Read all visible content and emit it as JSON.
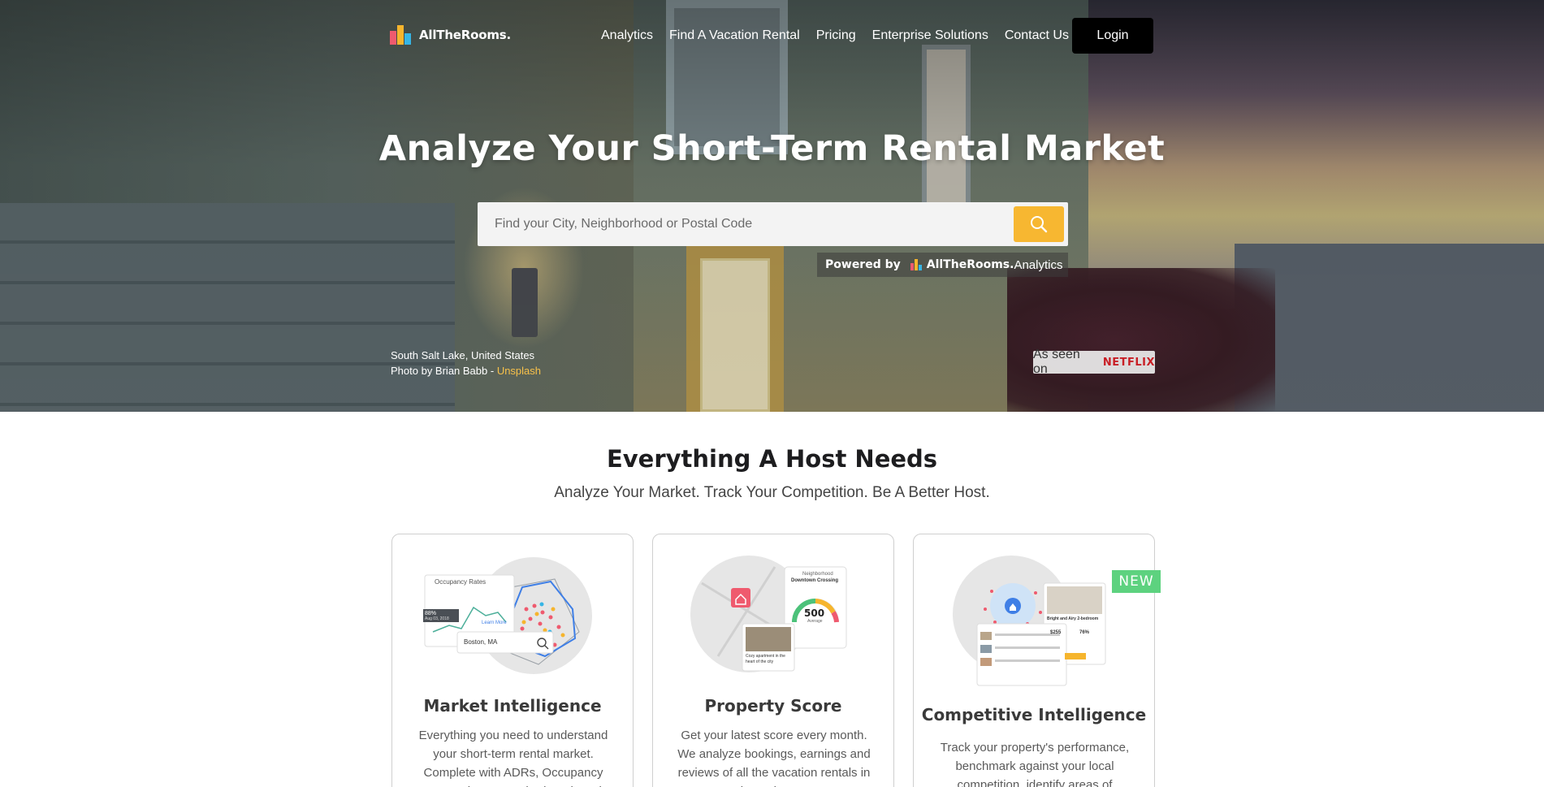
{
  "brand": {
    "name": "AllTheRooms.",
    "colors": {
      "red": "#ef5a6e",
      "yellow": "#f6b52d",
      "blue": "#36b5e5",
      "accent": "#f7b731",
      "netflix": "#c81e25",
      "new": "#5dd27f"
    }
  },
  "nav": {
    "links": [
      "Analytics",
      "Find A Vacation Rental",
      "Pricing",
      "Enterprise Solutions",
      "Contact Us"
    ],
    "login": "Login"
  },
  "hero": {
    "title": "Analyze Your Short-Term Rental Market",
    "search_placeholder": "Find your City, Neighborhood or Postal Code",
    "search_icon": "search-icon",
    "powered_label": "Powered by",
    "powered_brand": "AllTheRooms.",
    "powered_sub": "Analytics",
    "credit_location": "South Salt Lake, United States",
    "credit_photo": "Photo by Brian Babb - ",
    "credit_link": "Unsplash",
    "as_seen_on": "As seen on",
    "netflix": "NETFLIX"
  },
  "features": {
    "title": "Everything A Host Needs",
    "subtitle": "Analyze Your Market. Track Your Competition. Be A Better Host.",
    "cards": [
      {
        "title": "Market Intelligence",
        "description": "Everything you need to understand your short-term rental market. Complete with ADRs, Occupancy Rates and Revenue broken down by",
        "illus": {
          "panel_title": "Occupancy Rates",
          "tooltip_value": "88%",
          "tooltip_date": "Aug 03, 2018",
          "link": "Learn More",
          "search_value": "Boston, MA"
        }
      },
      {
        "title": "Property Score",
        "description": "Get your latest score every month. We analyze bookings, earnings and reviews of all the vacation rentals in your city and compare to",
        "illus": {
          "neighborhood_label": "Neighborhood",
          "neighborhood_name": "Downtown Crossing",
          "score": "500",
          "score_label": "Average",
          "listing_caption": "Cozy apartment in the heart of the city"
        }
      },
      {
        "title": "Competitive Intelligence",
        "description": "Track your property's performance, benchmark against your local competition, identify areas of",
        "badge": "NEW",
        "illus": {
          "listing_title": "Bright and Airy 2-bedroom",
          "price": "$255",
          "occupancy": "76%"
        }
      }
    ]
  }
}
